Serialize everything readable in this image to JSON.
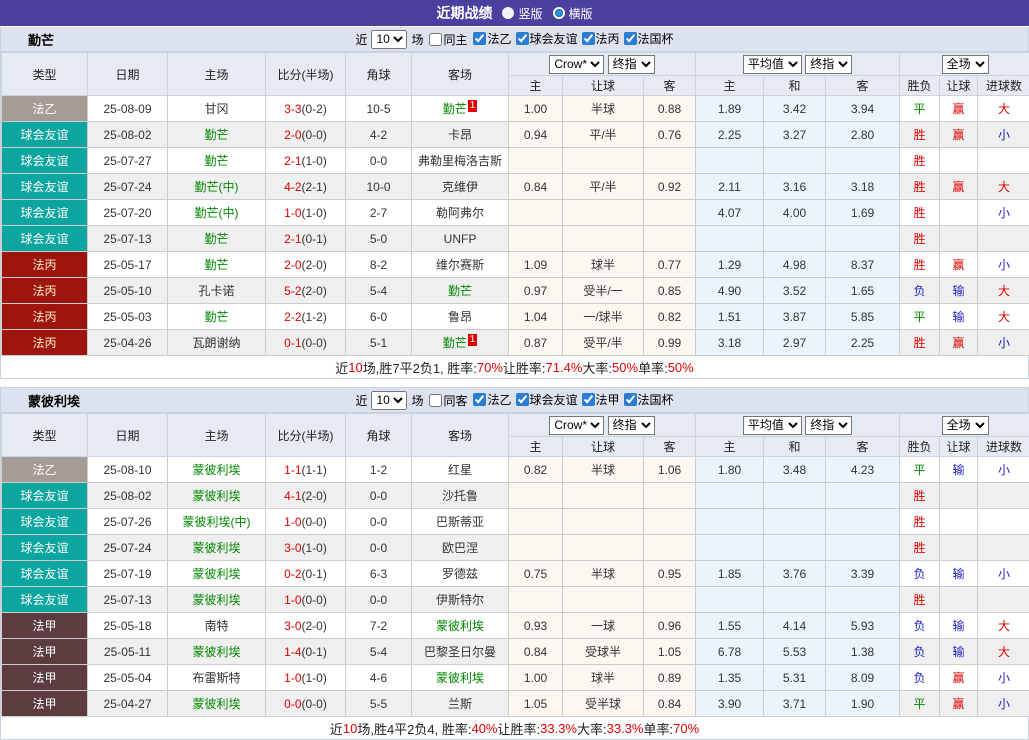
{
  "titlebar": {
    "title": "近期战绩",
    "layout_options": [
      {
        "label": "竖版",
        "checked": false
      },
      {
        "label": "横版",
        "checked": true
      }
    ]
  },
  "controls": {
    "recent": "近",
    "matches": "场"
  },
  "columns": {
    "type": "类型",
    "date": "日期",
    "home": "主场",
    "score": "比分(半场)",
    "corner": "角球",
    "away": "客场",
    "sub": [
      "主",
      "让球",
      "客",
      "主",
      "和",
      "客",
      "胜负",
      "让球",
      "进球数"
    ]
  },
  "selects": {
    "book": "Crow*",
    "final": "终指",
    "avg": "平均值",
    "final2": "终指",
    "scope": "全场"
  },
  "league_styles": {
    "法乙": {
      "bg": "#a59c95",
      "fg": "#ffffff"
    },
    "球会友谊": {
      "bg": "#0da5a0",
      "fg": "#ffffff"
    },
    "法丙": {
      "bg": "#9e150e",
      "fg": "#ffedc9"
    },
    "法甲": {
      "bg": "#5c3c3e",
      "fg": "#ffffff"
    },
    "法国杯": {
      "bg": "#888888",
      "fg": "#ffffff"
    }
  },
  "value_colors": {
    "胜": "#e10000",
    "平": "#008800",
    "负": "#2222cc",
    "赢": "#e10000",
    "输": "#2222cc",
    "大": "#e10000",
    "小": "#2222cc"
  },
  "tables": [
    {
      "team": "勤芒",
      "matches_count": "10",
      "same_label": "同主",
      "leagues": [
        "法乙",
        "球会友谊",
        "法丙",
        "法国杯"
      ],
      "rows": [
        {
          "league": "法乙",
          "date": "25-08-09",
          "home": "甘冈",
          "home_is_team": false,
          "score": "3-3",
          "half": "(0-2)",
          "corner": "10-5",
          "away": "勤芒",
          "away_is_team": true,
          "away_badge": "1",
          "o1": "1.00",
          "oh": "半球",
          "o2": "0.88",
          "a1": "1.89",
          "a2": "3.42",
          "a3": "3.94",
          "res": "平",
          "hcp": "赢",
          "goal": "大"
        },
        {
          "league": "球会友谊",
          "date": "25-08-02",
          "home": "勤芒",
          "home_is_team": true,
          "score": "2-0",
          "half": "(0-0)",
          "corner": "4-2",
          "away": "卡昂",
          "away_is_team": false,
          "away_badge": "",
          "o1": "0.94",
          "oh": "平/半",
          "o2": "0.76",
          "a1": "2.25",
          "a2": "3.27",
          "a3": "2.80",
          "res": "胜",
          "hcp": "赢",
          "goal": "小"
        },
        {
          "league": "球会友谊",
          "date": "25-07-27",
          "home": "勤芒",
          "home_is_team": true,
          "score": "2-1",
          "half": "(1-0)",
          "corner": "0-0",
          "away": "弗勒里梅洛吉斯",
          "away_is_team": false,
          "away_badge": "",
          "o1": "",
          "oh": "",
          "o2": "",
          "a1": "",
          "a2": "",
          "a3": "",
          "res": "胜",
          "hcp": "",
          "goal": ""
        },
        {
          "league": "球会友谊",
          "date": "25-07-24",
          "home": "勤芒(中)",
          "home_is_team": true,
          "score": "4-2",
          "half": "(2-1)",
          "corner": "10-0",
          "away": "克维伊",
          "away_is_team": false,
          "away_badge": "",
          "o1": "0.84",
          "oh": "平/半",
          "o2": "0.92",
          "a1": "2.11",
          "a2": "3.16",
          "a3": "3.18",
          "res": "胜",
          "hcp": "赢",
          "goal": "大"
        },
        {
          "league": "球会友谊",
          "date": "25-07-20",
          "home": "勤芒(中)",
          "home_is_team": true,
          "score": "1-0",
          "half": "(1-0)",
          "corner": "2-7",
          "away": "勒阿弗尔",
          "away_is_team": false,
          "away_badge": "",
          "o1": "",
          "oh": "",
          "o2": "",
          "a1": "4.07",
          "a2": "4.00",
          "a3": "1.69",
          "res": "胜",
          "hcp": "",
          "goal": "小"
        },
        {
          "league": "球会友谊",
          "date": "25-07-13",
          "home": "勤芒",
          "home_is_team": true,
          "score": "2-1",
          "half": "(0-1)",
          "corner": "5-0",
          "away": "UNFP",
          "away_is_team": false,
          "away_badge": "",
          "o1": "",
          "oh": "",
          "o2": "",
          "a1": "",
          "a2": "",
          "a3": "",
          "res": "胜",
          "hcp": "",
          "goal": ""
        },
        {
          "league": "法丙",
          "date": "25-05-17",
          "home": "勤芒",
          "home_is_team": true,
          "score": "2-0",
          "half": "(2-0)",
          "corner": "8-2",
          "away": "维尔赛斯",
          "away_is_team": false,
          "away_badge": "",
          "o1": "1.09",
          "oh": "球半",
          "o2": "0.77",
          "a1": "1.29",
          "a2": "4.98",
          "a3": "8.37",
          "res": "胜",
          "hcp": "赢",
          "goal": "小"
        },
        {
          "league": "法丙",
          "date": "25-05-10",
          "home": "孔卡诺",
          "home_is_team": false,
          "score": "5-2",
          "half": "(2-0)",
          "corner": "5-4",
          "away": "勤芒",
          "away_is_team": true,
          "away_badge": "",
          "o1": "0.97",
          "oh": "受半/一",
          "o2": "0.85",
          "a1": "4.90",
          "a2": "3.52",
          "a3": "1.65",
          "res": "负",
          "hcp": "输",
          "goal": "大"
        },
        {
          "league": "法丙",
          "date": "25-05-03",
          "home": "勤芒",
          "home_is_team": true,
          "score": "2-2",
          "half": "(1-2)",
          "corner": "6-0",
          "away": "鲁昂",
          "away_is_team": false,
          "away_badge": "",
          "o1": "1.04",
          "oh": "一/球半",
          "o2": "0.82",
          "a1": "1.51",
          "a2": "3.87",
          "a3": "5.85",
          "res": "平",
          "hcp": "输",
          "goal": "大"
        },
        {
          "league": "法丙",
          "date": "25-04-26",
          "home": "瓦朗谢纳",
          "home_is_team": false,
          "score": "0-1",
          "half": "(0-0)",
          "corner": "5-1",
          "away": "勤芒",
          "away_is_team": true,
          "away_badge": "1",
          "o1": "0.87",
          "oh": "受平/半",
          "o2": "0.99",
          "a1": "3.18",
          "a2": "2.97",
          "a3": "2.25",
          "res": "胜",
          "hcp": "赢",
          "goal": "小"
        }
      ],
      "summary": [
        {
          "t": "近",
          "red": false
        },
        {
          "t": "10",
          "red": true
        },
        {
          "t": "场,胜7平2负1, 胜率:",
          "red": false
        },
        {
          "t": "70%",
          "red": true
        },
        {
          "t": " 让胜率:",
          "red": false
        },
        {
          "t": "71.4%",
          "red": true
        },
        {
          "t": " 大率:",
          "red": false
        },
        {
          "t": "50%",
          "red": true
        },
        {
          "t": " 单率:",
          "red": false
        },
        {
          "t": "50%",
          "red": true
        }
      ]
    },
    {
      "team": "蒙彼利埃",
      "matches_count": "10",
      "same_label": "同客",
      "leagues": [
        "法乙",
        "球会友谊",
        "法甲",
        "法国杯"
      ],
      "rows": [
        {
          "league": "法乙",
          "date": "25-08-10",
          "home": "蒙彼利埃",
          "home_is_team": true,
          "score": "1-1",
          "half": "(1-1)",
          "corner": "1-2",
          "away": "红星",
          "away_is_team": false,
          "away_badge": "",
          "o1": "0.82",
          "oh": "半球",
          "o2": "1.06",
          "a1": "1.80",
          "a2": "3.48",
          "a3": "4.23",
          "res": "平",
          "hcp": "输",
          "goal": "小"
        },
        {
          "league": "球会友谊",
          "date": "25-08-02",
          "home": "蒙彼利埃",
          "home_is_team": true,
          "score": "4-1",
          "half": "(2-0)",
          "corner": "0-0",
          "away": "沙托鲁",
          "away_is_team": false,
          "away_badge": "",
          "o1": "",
          "oh": "",
          "o2": "",
          "a1": "",
          "a2": "",
          "a3": "",
          "res": "胜",
          "hcp": "",
          "goal": ""
        },
        {
          "league": "球会友谊",
          "date": "25-07-26",
          "home": "蒙彼利埃(中)",
          "home_is_team": true,
          "score": "1-0",
          "half": "(0-0)",
          "corner": "0-0",
          "away": "巴斯蒂亚",
          "away_is_team": false,
          "away_badge": "",
          "o1": "",
          "oh": "",
          "o2": "",
          "a1": "",
          "a2": "",
          "a3": "",
          "res": "胜",
          "hcp": "",
          "goal": ""
        },
        {
          "league": "球会友谊",
          "date": "25-07-24",
          "home": "蒙彼利埃",
          "home_is_team": true,
          "score": "3-0",
          "half": "(1-0)",
          "corner": "0-0",
          "away": "欧巴涅",
          "away_is_team": false,
          "away_badge": "",
          "o1": "",
          "oh": "",
          "o2": "",
          "a1": "",
          "a2": "",
          "a3": "",
          "res": "胜",
          "hcp": "",
          "goal": ""
        },
        {
          "league": "球会友谊",
          "date": "25-07-19",
          "home": "蒙彼利埃",
          "home_is_team": true,
          "score": "0-2",
          "half": "(0-1)",
          "corner": "6-3",
          "away": "罗德兹",
          "away_is_team": false,
          "away_badge": "",
          "o1": "0.75",
          "oh": "半球",
          "o2": "0.95",
          "a1": "1.85",
          "a2": "3.76",
          "a3": "3.39",
          "res": "负",
          "hcp": "输",
          "goal": "小"
        },
        {
          "league": "球会友谊",
          "date": "25-07-13",
          "home": "蒙彼利埃",
          "home_is_team": true,
          "score": "1-0",
          "half": "(0-0)",
          "corner": "0-0",
          "away": "伊斯特尔",
          "away_is_team": false,
          "away_badge": "",
          "o1": "",
          "oh": "",
          "o2": "",
          "a1": "",
          "a2": "",
          "a3": "",
          "res": "胜",
          "hcp": "",
          "goal": ""
        },
        {
          "league": "法甲",
          "date": "25-05-18",
          "home": "南特",
          "home_is_team": false,
          "score": "3-0",
          "half": "(2-0)",
          "corner": "7-2",
          "away": "蒙彼利埃",
          "away_is_team": true,
          "away_badge": "",
          "o1": "0.93",
          "oh": "一球",
          "o2": "0.96",
          "a1": "1.55",
          "a2": "4.14",
          "a3": "5.93",
          "res": "负",
          "hcp": "输",
          "goal": "大"
        },
        {
          "league": "法甲",
          "date": "25-05-11",
          "home": "蒙彼利埃",
          "home_is_team": true,
          "score": "1-4",
          "half": "(0-1)",
          "corner": "5-4",
          "away": "巴黎圣日尔曼",
          "away_is_team": false,
          "away_badge": "",
          "o1": "0.84",
          "oh": "受球半",
          "o2": "1.05",
          "a1": "6.78",
          "a2": "5.53",
          "a3": "1.38",
          "res": "负",
          "hcp": "输",
          "goal": "大"
        },
        {
          "league": "法甲",
          "date": "25-05-04",
          "home": "布雷斯特",
          "home_is_team": false,
          "score": "1-0",
          "half": "(1-0)",
          "corner": "4-6",
          "away": "蒙彼利埃",
          "away_is_team": true,
          "away_badge": "",
          "o1": "1.00",
          "oh": "球半",
          "o2": "0.89",
          "a1": "1.35",
          "a2": "5.31",
          "a3": "8.09",
          "res": "负",
          "hcp": "赢",
          "goal": "小"
        },
        {
          "league": "法甲",
          "date": "25-04-27",
          "home": "蒙彼利埃",
          "home_is_team": true,
          "score": "0-0",
          "half": "(0-0)",
          "corner": "5-5",
          "away": "兰斯",
          "away_is_team": false,
          "away_badge": "",
          "o1": "1.05",
          "oh": "受半球",
          "o2": "0.84",
          "a1": "3.90",
          "a2": "3.71",
          "a3": "1.90",
          "res": "平",
          "hcp": "赢",
          "goal": "小"
        }
      ],
      "summary": [
        {
          "t": "近",
          "red": false
        },
        {
          "t": "10",
          "red": true
        },
        {
          "t": "场,胜4平2负4, 胜率:",
          "red": false
        },
        {
          "t": "40%",
          "red": true
        },
        {
          "t": " 让胜率:",
          "red": false
        },
        {
          "t": "33.3%",
          "red": true
        },
        {
          "t": " 大率:",
          "red": false
        },
        {
          "t": "33.3%",
          "red": true
        },
        {
          "t": " 单率:",
          "red": false
        },
        {
          "t": "70%",
          "red": true
        }
      ]
    }
  ]
}
